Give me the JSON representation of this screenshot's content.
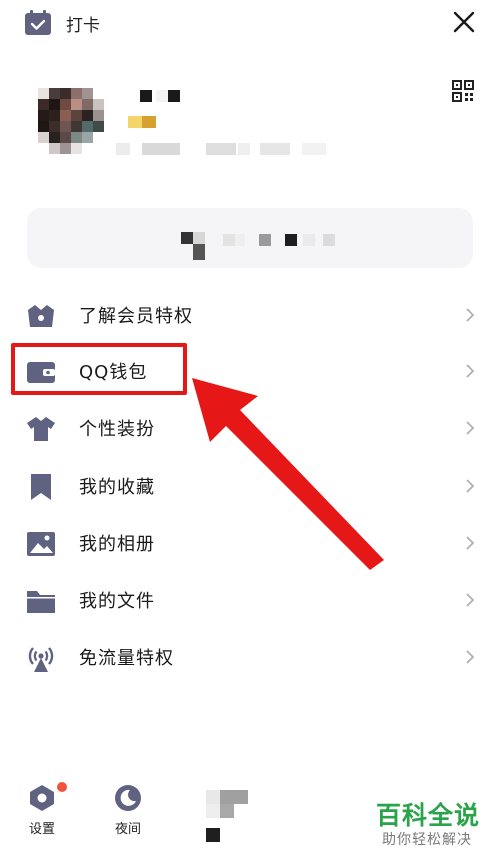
{
  "header": {
    "checkin_label": "打卡",
    "checkin_icon": "calendar-check-icon",
    "close_icon": "close-icon",
    "qr_icon": "qr-code-icon"
  },
  "menu": {
    "items": [
      {
        "label": "了解会员特权",
        "icon": "crown-icon"
      },
      {
        "label": "QQ钱包",
        "icon": "wallet-icon"
      },
      {
        "label": "个性装扮",
        "icon": "tshirt-icon"
      },
      {
        "label": "我的收藏",
        "icon": "bookmark-icon"
      },
      {
        "label": "我的相册",
        "icon": "photo-icon"
      },
      {
        "label": "我的文件",
        "icon": "folder-icon"
      },
      {
        "label": "免流量特权",
        "icon": "antenna-icon"
      }
    ],
    "chevron_icon": "chevron-right-icon"
  },
  "bottom": {
    "settings_label": "设置",
    "night_label": "夜间"
  },
  "watermark": {
    "title": "百科全说",
    "subtitle": "助你轻松解决"
  },
  "colors": {
    "icon": "#5f6381",
    "highlight": "#e61717",
    "notification": "#f0533c",
    "watermark": "#2aa34a"
  }
}
